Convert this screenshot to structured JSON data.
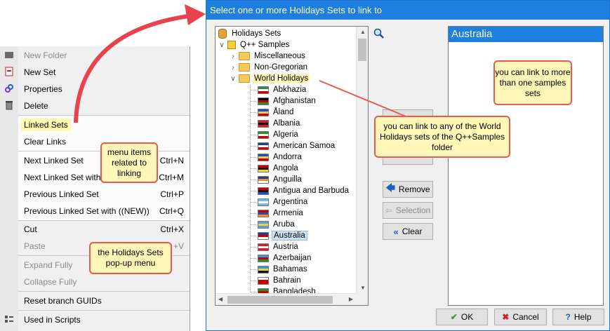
{
  "menu": {
    "items": [
      {
        "label": "New Folder",
        "shortcut": "",
        "disabled": true,
        "icon": "folder-icon"
      },
      {
        "label": "New Set",
        "shortcut": "",
        "disabled": false,
        "icon": "new-set-icon"
      },
      {
        "label": "Properties",
        "shortcut": "",
        "disabled": false,
        "icon": "properties-icon"
      },
      {
        "label": "Delete",
        "shortcut": "",
        "disabled": false,
        "icon": "trash-icon"
      },
      {
        "label": "Linked Sets",
        "shortcut": "",
        "disabled": false
      },
      {
        "label": "Clear Links",
        "shortcut": "",
        "disabled": false
      },
      {
        "label": "Next Linked Set",
        "shortcut": "Ctrl+N",
        "disabled": false
      },
      {
        "label": "Next Linked Set with (",
        "shortcut": "Ctrl+M",
        "disabled": false
      },
      {
        "label": "Previous Linked Set",
        "shortcut": "Ctrl+P",
        "disabled": false
      },
      {
        "label": "Previous Linked Set with ((NEW))",
        "shortcut": "Ctrl+Q",
        "disabled": false
      },
      {
        "label": "Cut",
        "shortcut": "Ctrl+X",
        "disabled": false
      },
      {
        "label": "Paste",
        "shortcut": "+V",
        "disabled": true
      },
      {
        "label": "Expand Fully",
        "shortcut": "",
        "disabled": true
      },
      {
        "label": "Collapse Fully",
        "shortcut": "",
        "disabled": true
      },
      {
        "label": "Reset branch GUIDs",
        "shortcut": "",
        "disabled": false
      },
      {
        "label": "Used in Scripts",
        "shortcut": "",
        "disabled": false,
        "icon": "scripts-icon"
      }
    ]
  },
  "dialog": {
    "title": "Select one or more Holidays Sets to link to",
    "tree": {
      "root": "Holidays Sets",
      "samples": "Q++ Samples",
      "folders": [
        "Miscellaneous",
        "Non-Gregorian",
        "World Holidays"
      ],
      "countries": [
        "Abkhazia",
        "Afghanistan",
        "Åland",
        "Albania",
        "Algeria",
        "American Samoa",
        "Andorra",
        "Angola",
        "Anguilla",
        "Antigua and Barbuda",
        "Argentina",
        "Armenia",
        "Aruba",
        "Australia",
        "Austria",
        "Azerbaijan",
        "Bahamas",
        "Bahrain",
        "Bangladesh"
      ],
      "selected": "Australia"
    },
    "buttons": {
      "remove": "Remove",
      "selection": "Selection",
      "clear": "Clear",
      "ok": "OK",
      "cancel": "Cancel",
      "help": "Help"
    },
    "linked": [
      "Australia"
    ]
  },
  "callouts": {
    "menu_items": "menu items related to linking",
    "popup_menu": "the Holidays Sets pop-up menu",
    "multi": "you can link to more than one samples sets",
    "world": "you can link to any of the World Holidays sets of the Q++Samples folder"
  },
  "colors": {
    "accent": "#1e7fe0",
    "callout_fill": "#fff6b8",
    "callout_border": "#e85a4f"
  }
}
